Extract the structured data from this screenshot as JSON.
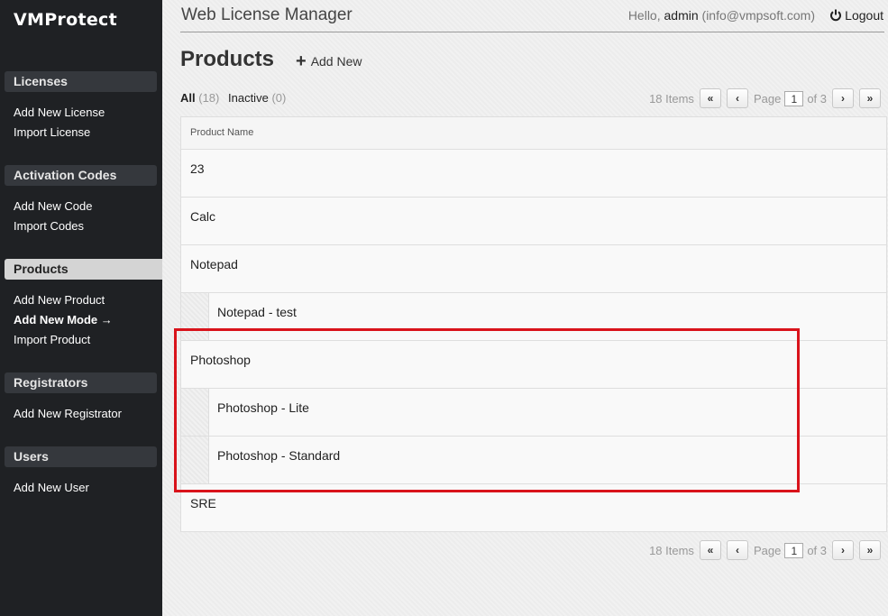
{
  "sidebar": {
    "logo": "VMProtect",
    "sections": [
      {
        "title": "Licenses",
        "links": [
          "Add New License",
          "Import License"
        ]
      },
      {
        "title": "Activation Codes",
        "links": [
          "Add New Code",
          "Import Codes"
        ]
      },
      {
        "title": "Products",
        "links": [
          "Add New Product",
          "Add New Mode →",
          "Import Product"
        ]
      },
      {
        "title": "Registrators",
        "links": [
          "Add New Registrator"
        ]
      },
      {
        "title": "Users",
        "links": [
          "Add New User"
        ]
      }
    ]
  },
  "header": {
    "app_title": "Web License Manager",
    "hello": "Hello,",
    "user": "admin",
    "email": "(info@vmpsoft.com)",
    "logout": "Logout"
  },
  "page": {
    "title": "Products",
    "add_new": "Add New"
  },
  "filters": {
    "all_label": "All",
    "all_count": "(18)",
    "inactive_label": "Inactive",
    "inactive_count": "(0)"
  },
  "pager": {
    "items": "18 Items",
    "page_label": "Page",
    "current_page": "1",
    "of_total": "of 3",
    "first": "«",
    "prev": "‹",
    "next": "›",
    "last": "»"
  },
  "table": {
    "column": "Product Name",
    "rows": [
      "23",
      "Calc",
      "Notepad",
      "Notepad - test",
      "Photoshop",
      "Photoshop - Lite",
      "Photoshop - Standard",
      "SRE"
    ]
  },
  "colors": {
    "sidebar_bg": "#1f2124",
    "highlight": "#d9131b"
  }
}
